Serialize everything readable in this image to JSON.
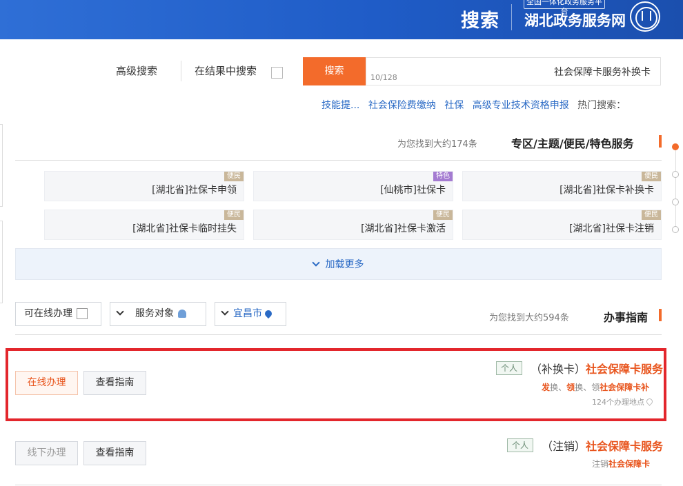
{
  "header": {
    "search_title": "搜索",
    "platform_label": "全国一体化政务服务平台",
    "site_name": "湖北政务服务网",
    "logo_icon": "hubei-emblem-icon"
  },
  "search": {
    "advanced_label": "高级搜索",
    "in_results_label": "在结果中搜索",
    "button_label": "搜索",
    "query": "社会保障卡服务补换卡",
    "char_count": "10/128"
  },
  "hot": {
    "label": "热门搜索：",
    "items": [
      "高级专业技术资格申报",
      "社保",
      "社会保险费缴纳",
      "技能提..."
    ]
  },
  "special_section": {
    "title": "专区/主题/便民/特色服务",
    "count_text": "为您找到大约174条",
    "cards": [
      {
        "text": "[湖北省]社保卡补换卡",
        "tag": "便民",
        "tag_color": "#c9b79a"
      },
      {
        "text": "[仙桃市]社保卡",
        "tag": "特色",
        "tag_color": "#a47bd1"
      },
      {
        "text": "[湖北省]社保卡申领",
        "tag": "便民",
        "tag_color": "#c9b79a"
      },
      {
        "text": "[湖北省]社保卡注销",
        "tag": "便民",
        "tag_color": "#c9b79a"
      },
      {
        "text": "[湖北省]社保卡激活",
        "tag": "便民",
        "tag_color": "#c9b79a"
      },
      {
        "text": "[湖北省]社保卡临时挂失",
        "tag": "便民",
        "tag_color": "#c9b79a"
      }
    ],
    "load_more": "加载更多"
  },
  "guide_section": {
    "title": "办事指南",
    "count_text": "为您找到大约594条",
    "filters": {
      "city": "宜昌市",
      "audience": "服务对象",
      "online_label": "可在线办理"
    }
  },
  "results": [
    {
      "title": "社会保障卡服务",
      "subtitle": "（补换卡）",
      "tag": "个人",
      "desc_parts": [
        "社会保障卡补",
        "领",
        "、",
        "换",
        "领",
        "、",
        "换",
        "发"
      ],
      "location": "124个办理地点",
      "guide_btn": "查看指南",
      "action_btn": "在线办理"
    },
    {
      "title": "社会保障卡服务",
      "subtitle": "（注销）",
      "tag": "个人",
      "desc_parts": [
        "社会保障卡",
        "注销"
      ],
      "guide_btn": "查看指南",
      "action_btn": "线下办理"
    }
  ]
}
